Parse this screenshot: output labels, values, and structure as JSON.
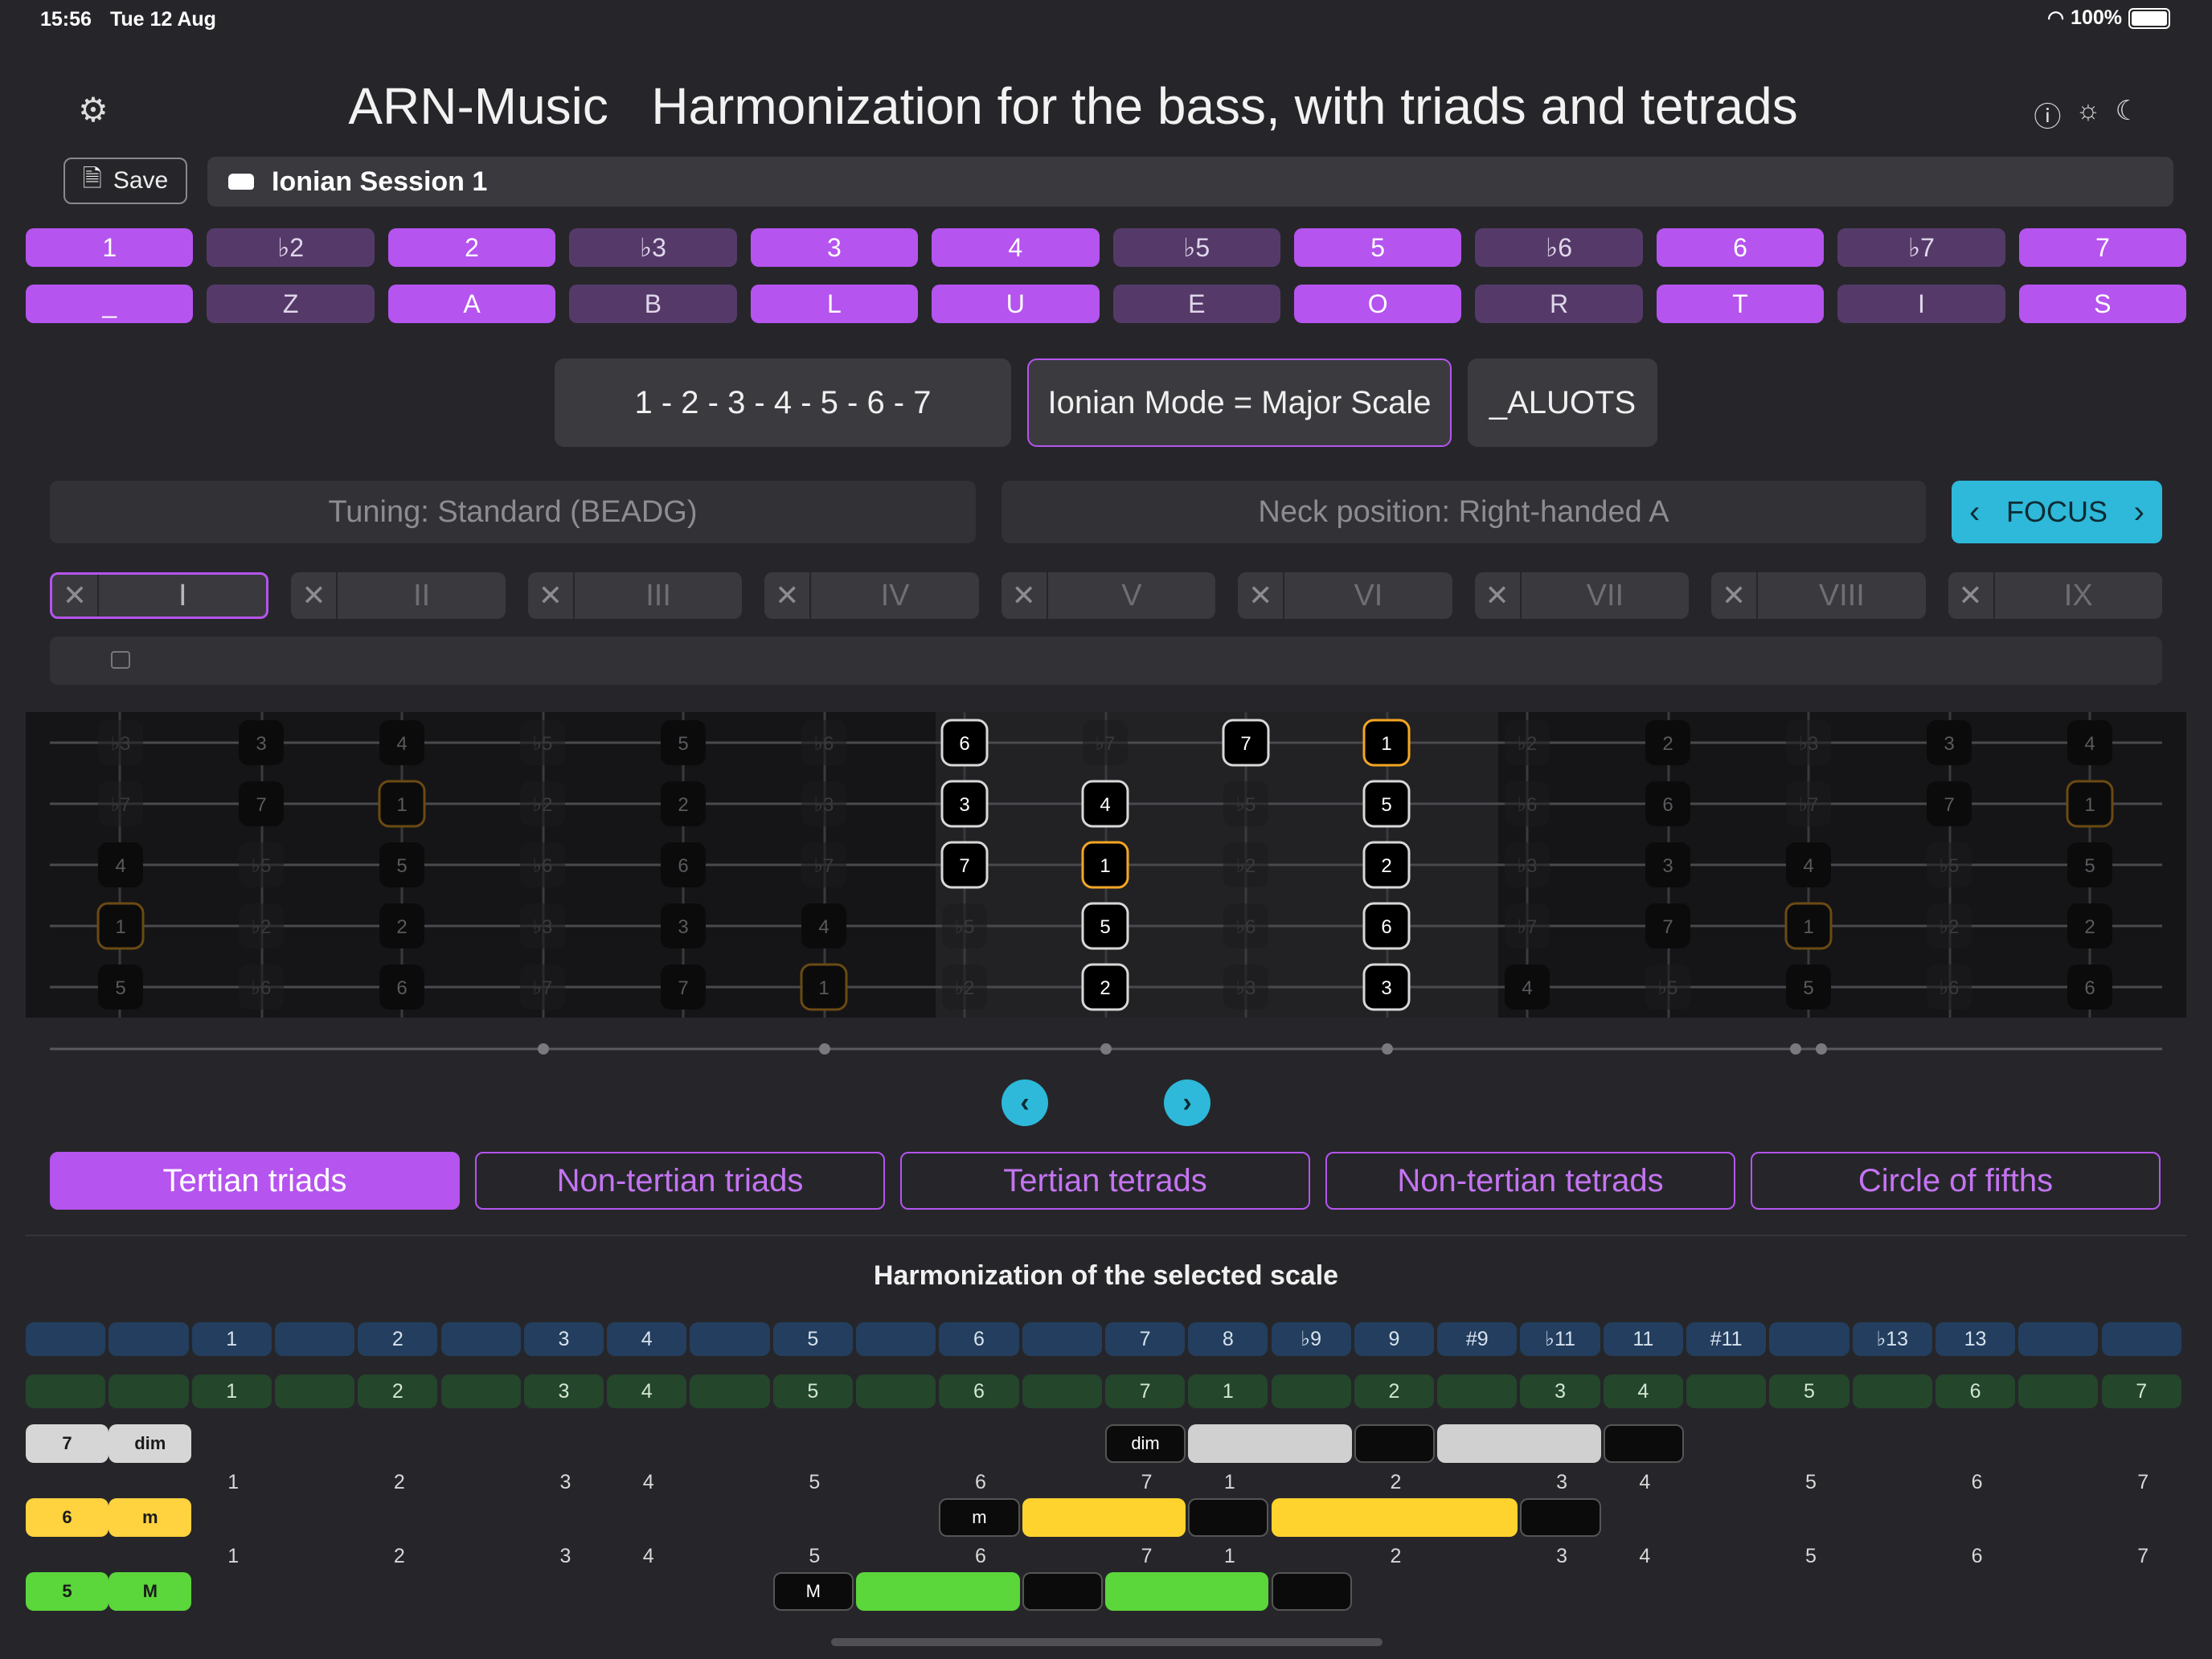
{
  "status": {
    "time": "15:56",
    "date": "Tue 12 Aug",
    "battery": "100%"
  },
  "header": {
    "title": "ARN-Music   Harmonization for the bass, with triads and tetrads"
  },
  "toolbar": {
    "save_label": "Save",
    "session_name": "Ionian Session 1"
  },
  "degrees": {
    "intervals": [
      "1",
      "♭2",
      "2",
      "♭3",
      "3",
      "4",
      "♭5",
      "5",
      "♭6",
      "6",
      "♭7",
      "7"
    ],
    "letters": [
      "_",
      "Z",
      "A",
      "B",
      "L",
      "U",
      "E",
      "O",
      "R",
      "T",
      "I",
      "S"
    ],
    "active": [
      true,
      false,
      true,
      false,
      true,
      true,
      false,
      true,
      false,
      true,
      false,
      true
    ]
  },
  "summary": {
    "formula": "1 - 2 - 3 - 4 - 5 - 6 - 7",
    "mode": "Ionian Mode = Major Scale",
    "code": "_ALUOTS"
  },
  "selectors": {
    "tuning": "Tuning: Standard (BEADG)",
    "neck": "Neck position: Right-handed A",
    "focus": "FOCUS"
  },
  "positions": [
    "I",
    "II",
    "III",
    "IV",
    "V",
    "VI",
    "VII",
    "VIII",
    "IX"
  ],
  "fretboard": {
    "strings": [
      [
        "♭3",
        "3",
        "4",
        "♭5",
        "5",
        "♭6",
        "6",
        "♭7",
        "7",
        "1",
        "♭2",
        "2",
        "♭3",
        "3",
        "4"
      ],
      [
        "♭7",
        "7",
        "1",
        "♭2",
        "2",
        "♭3",
        "3",
        "4",
        "♭5",
        "5",
        "♭6",
        "6",
        "♭7",
        "7",
        "1"
      ],
      [
        "4",
        "♭5",
        "5",
        "♭6",
        "6",
        "♭7",
        "7",
        "1",
        "♭2",
        "2",
        "♭3",
        "3",
        "4",
        "♭5",
        "5"
      ],
      [
        "1",
        "♭2",
        "2",
        "♭3",
        "3",
        "4",
        "♭5",
        "5",
        "♭6",
        "6",
        "♭7",
        "7",
        "1",
        "♭2",
        "2"
      ],
      [
        "5",
        "♭6",
        "6",
        "♭7",
        "7",
        "1",
        "♭2",
        "2",
        "♭3",
        "3",
        "4",
        "♭5",
        "5",
        "♭6",
        "6"
      ]
    ]
  },
  "tabs": [
    "Tertian triads",
    "Non-tertian triads",
    "Tertian tetrads",
    "Non-tertian tetrads",
    "Circle of fifths"
  ],
  "harmonization": {
    "title": "Harmonization of the selected scale",
    "intervals_row": [
      "",
      "",
      "1",
      "",
      "2",
      "",
      "3",
      "4",
      "",
      "5",
      "",
      "6",
      "",
      "7",
      "8",
      "♭9",
      "9",
      "#9",
      "♭11",
      "11",
      "#11",
      "",
      "♭13",
      "13",
      "",
      ""
    ],
    "degrees_row": [
      "",
      "",
      "1",
      "",
      "2",
      "",
      "3",
      "4",
      "",
      "5",
      "",
      "6",
      "",
      "7",
      "1",
      "",
      "2",
      "",
      "3",
      "4",
      "",
      "5",
      "",
      "6",
      "",
      "7"
    ],
    "num_line": [
      "1",
      "2",
      "3",
      "4",
      "5",
      "6",
      "7",
      "1",
      "2",
      "3",
      "4",
      "5",
      "6",
      "7"
    ],
    "chords": [
      {
        "degree": "7",
        "quality": "dim",
        "badge": "dim"
      },
      {
        "degree": "6",
        "quality": "m",
        "badge": "m"
      },
      {
        "degree": "5",
        "quality": "M",
        "badge": "M"
      }
    ]
  }
}
